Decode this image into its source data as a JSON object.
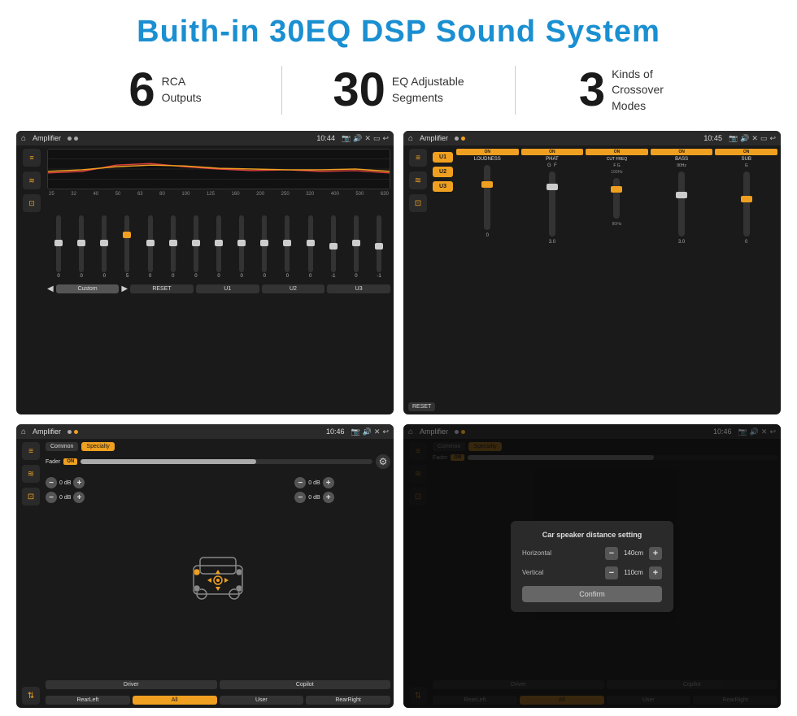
{
  "page": {
    "title": "Buith-in 30EQ DSP Sound System",
    "bg": "#ffffff"
  },
  "stats": [
    {
      "number": "6",
      "label1": "RCA",
      "label2": "Outputs"
    },
    {
      "number": "30",
      "label1": "EQ Adjustable",
      "label2": "Segments"
    },
    {
      "number": "3",
      "label1": "Kinds of",
      "label2": "Crossover Modes"
    }
  ],
  "screen1": {
    "statusbar": {
      "title": "Amplifier",
      "time": "10:44"
    },
    "freqs": [
      "25",
      "32",
      "40",
      "50",
      "63",
      "80",
      "100",
      "125",
      "160",
      "200",
      "250",
      "320",
      "400",
      "500",
      "630"
    ],
    "sliders": [
      0,
      0,
      0,
      5,
      0,
      0,
      0,
      0,
      0,
      0,
      0,
      0,
      -1,
      0,
      -1
    ],
    "preset": "Custom",
    "buttons": [
      "RESET",
      "U1",
      "U2",
      "U3"
    ]
  },
  "screen2": {
    "statusbar": {
      "title": "Amplifier",
      "time": "10:45"
    },
    "uButtons": [
      "U1",
      "U2",
      "U3"
    ],
    "channels": [
      "LOUDNESS",
      "PHAT",
      "CUT FREQ",
      "BASS",
      "SUB"
    ],
    "resetLabel": "RESET"
  },
  "screen3": {
    "statusbar": {
      "title": "Amplifier",
      "time": "10:46"
    },
    "tabs": [
      "Common",
      "Specialty"
    ],
    "faderLabel": "Fader",
    "onLabel": "ON",
    "speakerValues": [
      "0 dB",
      "0 dB",
      "0 dB",
      "0 dB"
    ],
    "buttons": [
      "Driver",
      "Copilot",
      "RearLeft",
      "All",
      "User",
      "RearRight"
    ]
  },
  "screen4": {
    "statusbar": {
      "title": "Amplifier",
      "time": "10:46"
    },
    "tabs": [
      "Common",
      "Specialty"
    ],
    "dialog": {
      "title": "Car speaker distance setting",
      "fields": [
        {
          "label": "Horizontal",
          "value": "140cm"
        },
        {
          "label": "Vertical",
          "value": "110cm"
        }
      ],
      "confirmLabel": "Confirm"
    }
  }
}
